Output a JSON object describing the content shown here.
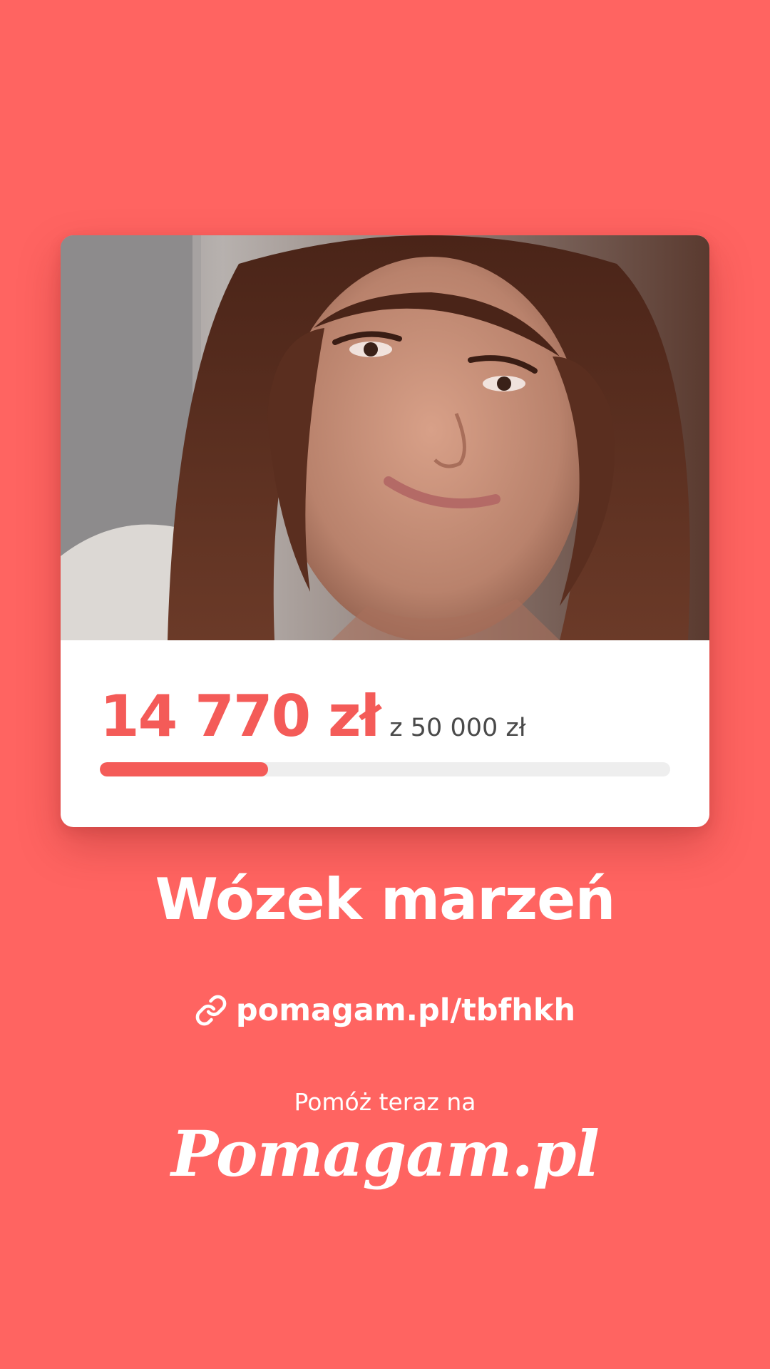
{
  "campaign": {
    "raised": "14 770 zł",
    "goal": "z 50 000 zł",
    "progress": 0.2954,
    "title": "Wózek marzeń"
  },
  "link": {
    "icon": "link-icon",
    "url": "pomagam.pl/tbfhkh"
  },
  "cta": {
    "text": "Pomóż teraz na",
    "logo": "Pomagam.pl"
  },
  "colors": {
    "background": "#FF6461",
    "accent": "#F45B58",
    "card": "#FFFFFF",
    "track": "#EEEEEE"
  }
}
